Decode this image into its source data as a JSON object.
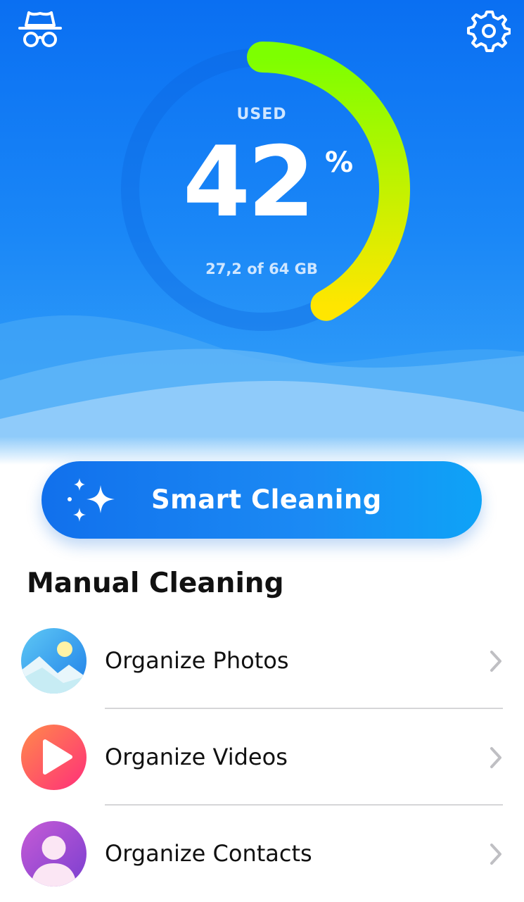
{
  "storage": {
    "used_label": "USED",
    "percent": "42",
    "percent_sign": "%",
    "used_fraction": 0.42,
    "capacity_text": "27,2 of 64 GB"
  },
  "smart_cleaning": {
    "label": "Smart Cleaning"
  },
  "manual": {
    "title": "Manual Cleaning",
    "items": [
      {
        "label": "Organize Photos",
        "icon": "photo-icon"
      },
      {
        "label": "Organize Videos",
        "icon": "video-icon"
      },
      {
        "label": "Organize Contacts",
        "icon": "contact-icon"
      }
    ]
  },
  "colors": {
    "hero_top": "#0a6ff2",
    "ring_start": "#7dff00",
    "ring_end": "#ffe600",
    "button": "#1a87f4"
  }
}
